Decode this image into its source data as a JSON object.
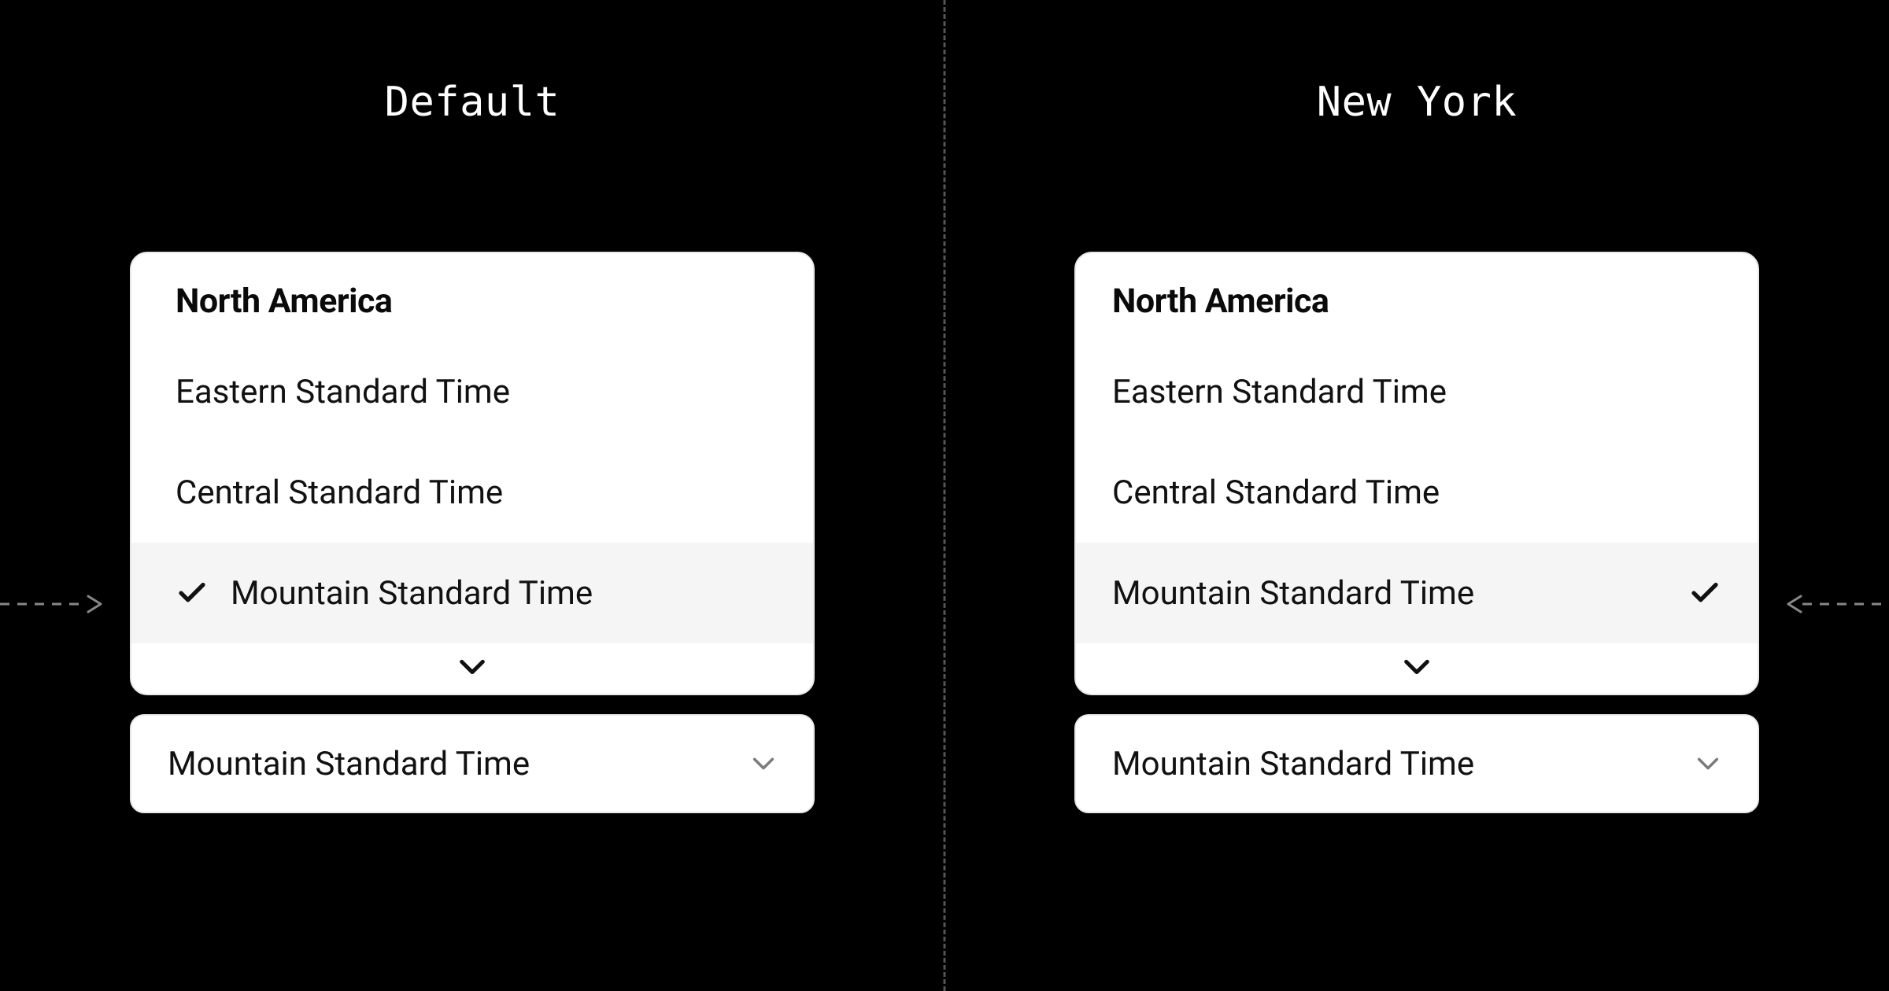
{
  "left": {
    "title": "Default",
    "group_label": "North America",
    "items": [
      {
        "label": "Eastern Standard Time",
        "selected": false
      },
      {
        "label": "Central Standard Time",
        "selected": false
      },
      {
        "label": "Mountain Standard Time",
        "selected": true
      }
    ],
    "trigger_value": "Mountain Standard Time"
  },
  "right": {
    "title": "New York",
    "group_label": "North America",
    "items": [
      {
        "label": "Eastern Standard Time",
        "selected": false
      },
      {
        "label": "Central Standard Time",
        "selected": false
      },
      {
        "label": "Mountain Standard Time",
        "selected": true
      }
    ],
    "trigger_value": "Mountain Standard Time"
  }
}
